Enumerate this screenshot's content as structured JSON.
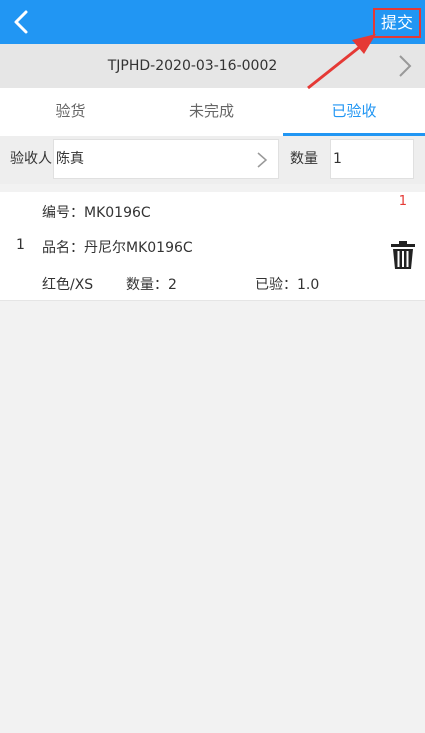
{
  "header": {
    "submit_label": "提交",
    "background_color": "#2196f3",
    "highlight_color": "#e53935"
  },
  "document": {
    "number": "TJPHD-2020-03-16-0002"
  },
  "tabs": [
    {
      "label": "验货",
      "active": false
    },
    {
      "label": "未完成",
      "active": false
    },
    {
      "label": "已验收",
      "active": true
    }
  ],
  "filter": {
    "inspector_label": "验收人",
    "inspector_value": "陈真",
    "quantity_label": "数量",
    "quantity_value": "1"
  },
  "items": [
    {
      "index": "1",
      "code": "编号：MK0196C",
      "name": "品名：丹尼尔MK0196C",
      "color_size": "红色/XS",
      "quantity": "数量：2",
      "inspected": "已验：1.0",
      "badge": "1"
    }
  ],
  "icons": {
    "back": "chevron-left-icon",
    "document_next": "chevron-right-icon",
    "inspector_select": "chevron-right-icon",
    "delete": "trash-icon"
  }
}
